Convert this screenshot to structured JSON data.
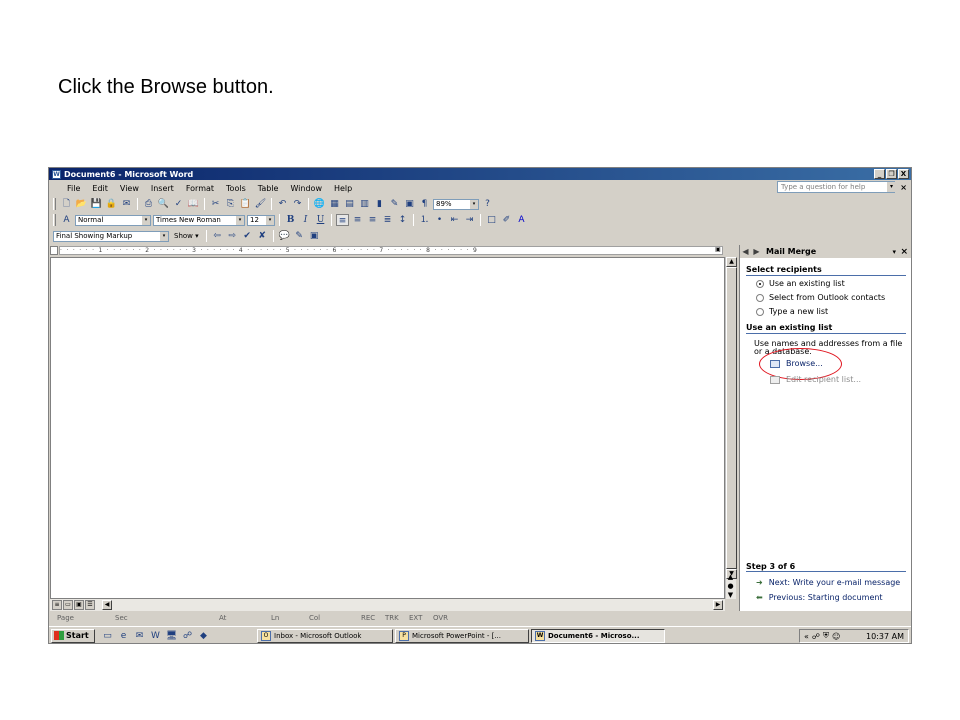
{
  "instruction": "Click the Browse button.",
  "window": {
    "title": "Document6 - Microsoft Word",
    "buttons": [
      "_",
      "❐",
      "X"
    ]
  },
  "menu": {
    "items": [
      "File",
      "Edit",
      "View",
      "Insert",
      "Format",
      "Tools",
      "Table",
      "Window",
      "Help"
    ],
    "ask_placeholder": "Type a question for help",
    "close": "×"
  },
  "toolbar": {
    "zoom": "89%",
    "style": "Normal",
    "font": "Times New Roman",
    "size": "12",
    "bold": "B",
    "italic": "I",
    "underline": "U",
    "markup_mode": "Final Showing Markup",
    "show_label": "Show ▾"
  },
  "ruler": {
    "text": "· · · · · · 1 · · · · · · 2 · · · · · · 3 · · · · · · 4 · · · · · · 5 · · · · · · 6 · · · · · · 7 · · · · · · 8 · · · · · · 9",
    "end_marker": "▣"
  },
  "task_pane": {
    "title": "Mail Merge",
    "select_recipients_heading": "Select recipients",
    "options": [
      {
        "label": "Use an existing list",
        "selected": true
      },
      {
        "label": "Select from Outlook contacts",
        "selected": false
      },
      {
        "label": "Type a new list",
        "selected": false
      }
    ],
    "existing_list_heading": "Use an existing list",
    "existing_list_text": "Use names and addresses from a file or a database.",
    "browse_label": "Browse...",
    "edit_list_label": "Edit recipient list...",
    "step_label": "Step 3 of 6",
    "next_label": "Next: Write your e-mail message",
    "previous_label": "Previous: Starting document"
  },
  "status_bar": {
    "page": "Page",
    "sec": "Sec",
    "at": "At",
    "ln": "Ln",
    "col": "Col",
    "rec": "REC",
    "trk": "TRK",
    "ext": "EXT",
    "ovr": "OVR"
  },
  "taskbar": {
    "start_label": "Start",
    "tasks": [
      {
        "label": "Inbox - Microsoft Outlook",
        "active": false
      },
      {
        "label": "Microsoft PowerPoint - [...",
        "active": false
      },
      {
        "label": "Document6 - Microso...",
        "active": true
      }
    ],
    "clock": "10:37 AM"
  },
  "colors": {
    "title_bar": "#0a246a",
    "link": "#0a246a",
    "highlight_circle": "#e0141e"
  }
}
